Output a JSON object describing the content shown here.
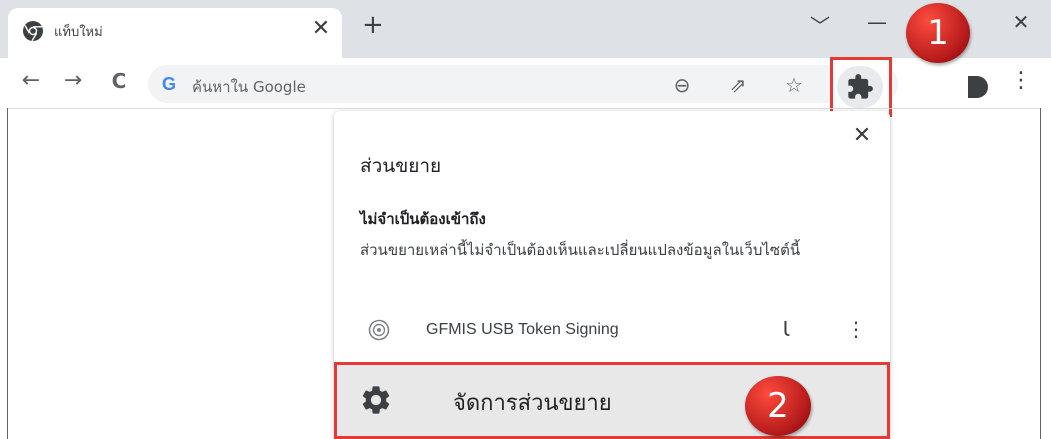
{
  "tab": {
    "title": "แท็บใหม่",
    "close": "✕"
  },
  "new_tab": "+",
  "window_controls": {
    "dropdown": "﹀",
    "minimize": "—",
    "restore": "❐",
    "close": "✕"
  },
  "toolbar": {
    "back": "←",
    "forward": "→",
    "reload": "C",
    "omnibox_logo": "G",
    "omnibox_placeholder": "ค้นหาใน Google",
    "zoom_icon": "⊖",
    "share_icon": "⇗",
    "bookmark_icon": "☆",
    "menu": "⋮"
  },
  "badges": {
    "step1": "1",
    "step2": "2"
  },
  "extensions_popup": {
    "close": "✕",
    "title": "ส่วนขยาย",
    "section_title": "ไม่จำเป็นต้องเข้าถึง",
    "section_desc": "ส่วนขยายเหล่านี้ไม่จำเป็นต้องเห็นและเปลี่ยนแปลงข้อมูลในเว็บไซต์นี้",
    "extensions": [
      {
        "name": "GFMIS USB Token Signing",
        "pin": "Ꙇ",
        "menu": "⋮"
      }
    ],
    "manage_label": "จัดการส่วนขยาย"
  },
  "colors": {
    "highlight": "#e53935",
    "badge": "#c62828",
    "titlebar": "#dee1e6"
  }
}
